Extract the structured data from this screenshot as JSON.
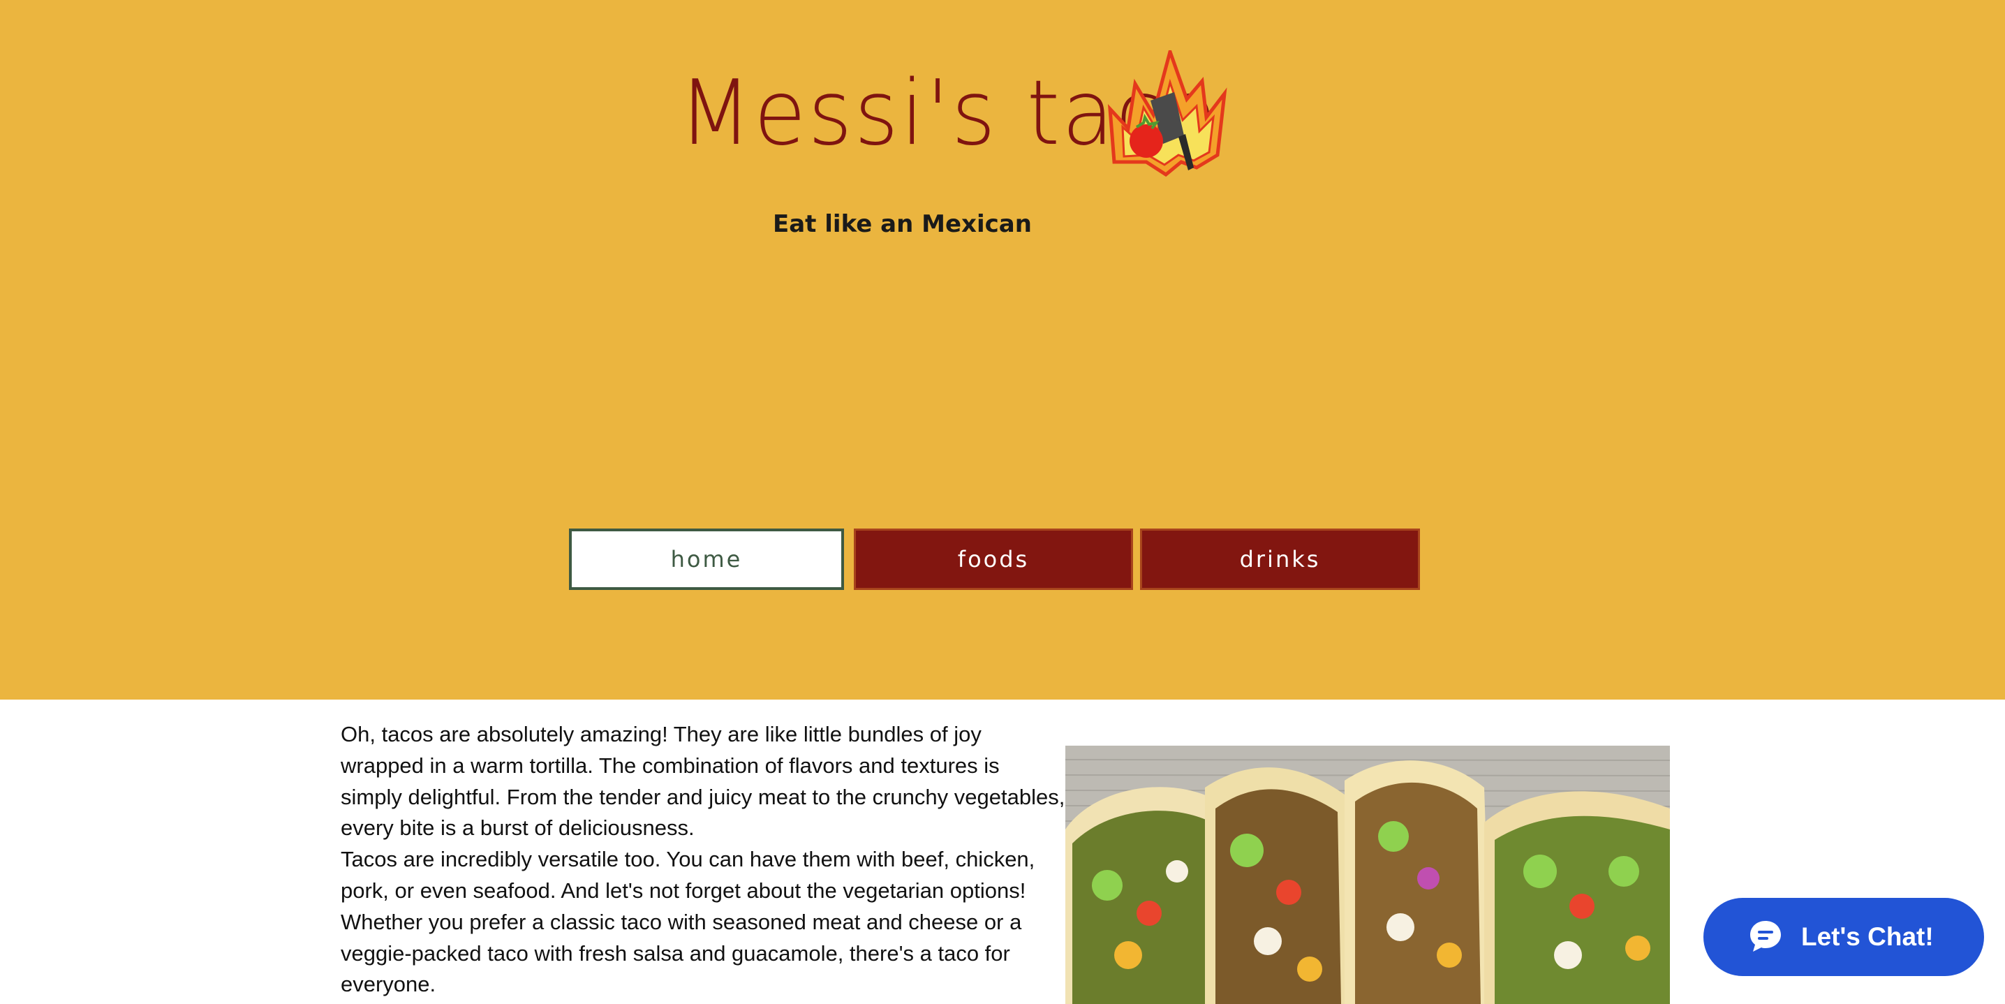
{
  "header": {
    "site_title": "Messi's taco",
    "tagline": "Eat like an Mexican",
    "logo_icon": "flaming-taco-logo-icon"
  },
  "nav": {
    "items": [
      {
        "label": "home",
        "active": true
      },
      {
        "label": "foods",
        "active": false
      },
      {
        "label": "drinks",
        "active": false
      }
    ]
  },
  "content": {
    "paragraph_1": "Oh, tacos are absolutely amazing! They are like little bundles of joy wrapped in a warm tortilla. The combination of flavors and textures is simply delightful. From the tender and juicy meat to the crunchy vegetables, every bite is a burst of deliciousness.",
    "paragraph_2": "Tacos are incredibly versatile too. You can have them with beef, chicken, pork, or even seafood. And let's not forget about the vegetarian options! Whether you prefer a classic taco with seasoned meat and cheese or a veggie-packed taco with fresh salsa and guacamole, there's a taco for everyone.",
    "photo_subject": "tacos-photo"
  },
  "chat": {
    "label": "Let's Chat!",
    "icon": "chat-bubble-icon"
  },
  "colors": {
    "header_bg": "#ebb53f",
    "brand_red": "#821610",
    "title_color": "#7f1410",
    "home_text": "#3e5a43",
    "chat_blue": "#2254d6"
  }
}
